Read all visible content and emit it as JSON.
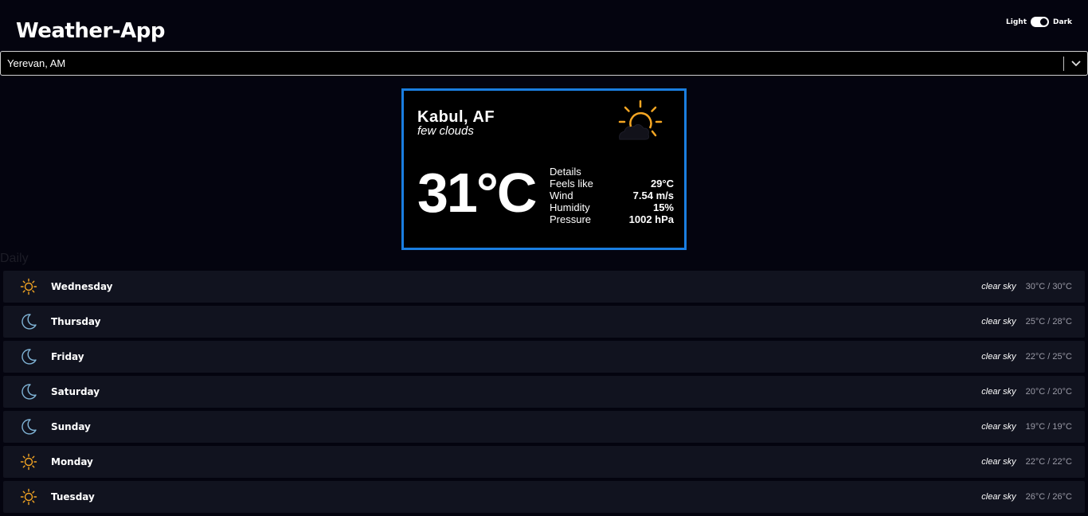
{
  "header": {
    "title": "Weather-App",
    "theme_light_label": "Light",
    "theme_dark_label": "Dark",
    "theme_selected": "dark"
  },
  "search": {
    "selected_city": "Yerevan, AM"
  },
  "current": {
    "city": "Kabul, AF",
    "description": "few clouds",
    "temperature": "31°C",
    "icon": "sun-behind-cloud-icon",
    "details_heading": "Details",
    "details": [
      {
        "label": "Feels like",
        "value": "29°C"
      },
      {
        "label": "Wind",
        "value": "7.54 m/s"
      },
      {
        "label": "Humidity",
        "value": "15%"
      },
      {
        "label": "Pressure",
        "value": "1002 hPa"
      }
    ]
  },
  "daily": {
    "heading": "Daily",
    "days": [
      {
        "day": "Wednesday",
        "icon": "sun-icon",
        "description": "clear sky",
        "temp": "30°C / 30°C"
      },
      {
        "day": "Thursday",
        "icon": "moon-icon",
        "description": "clear sky",
        "temp": "25°C / 28°C"
      },
      {
        "day": "Friday",
        "icon": "moon-icon",
        "description": "clear sky",
        "temp": "22°C / 25°C"
      },
      {
        "day": "Saturday",
        "icon": "moon-icon",
        "description": "clear sky",
        "temp": "20°C / 20°C"
      },
      {
        "day": "Sunday",
        "icon": "moon-icon",
        "description": "clear sky",
        "temp": "19°C / 19°C"
      },
      {
        "day": "Monday",
        "icon": "sun-icon",
        "description": "clear sky",
        "temp": "22°C / 22°C"
      },
      {
        "day": "Tuesday",
        "icon": "sun-icon",
        "description": "clear sky",
        "temp": "26°C / 26°C"
      }
    ]
  },
  "colors": {
    "background": "#04040f",
    "card_border": "#1a7ee0",
    "sun": "#f5a623",
    "moon": "#7fb3d5",
    "row_background": "#11131f"
  }
}
